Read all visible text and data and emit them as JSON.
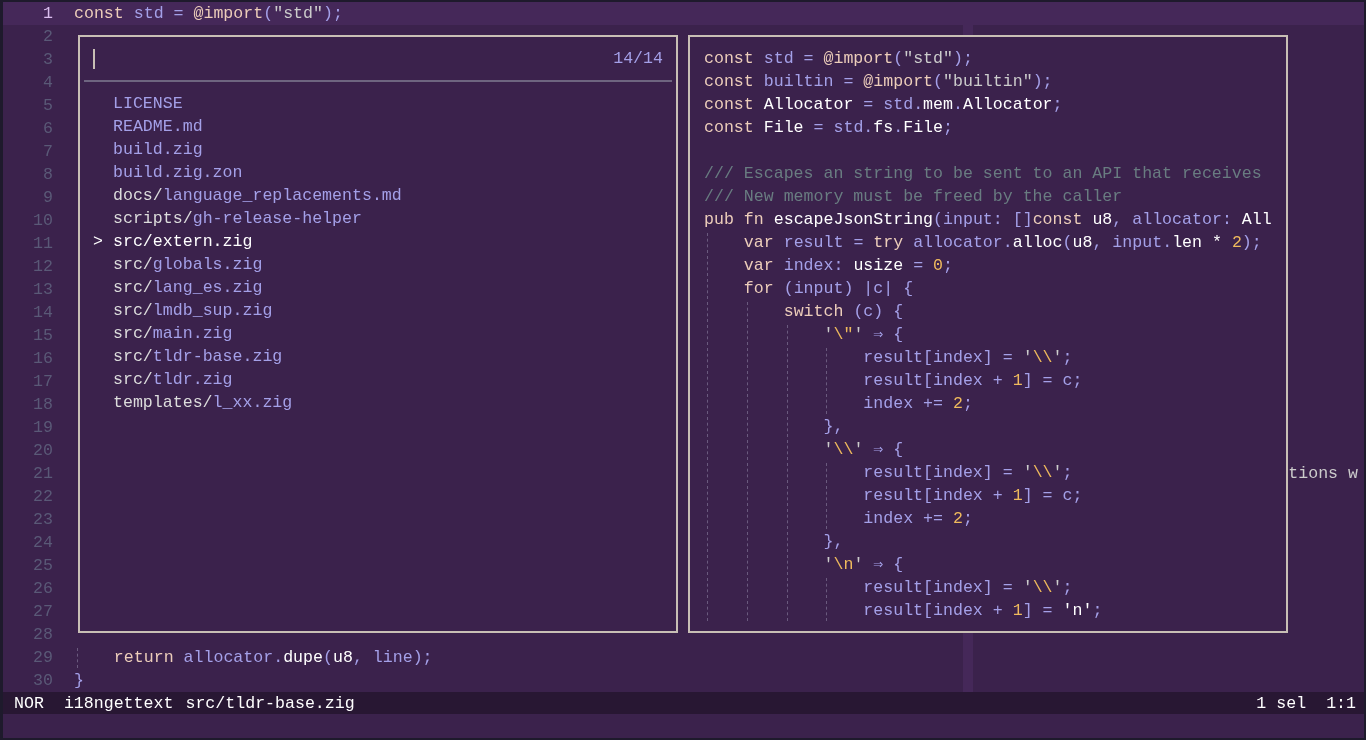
{
  "editor": {
    "lines": [
      {
        "number": "1",
        "kind": "code",
        "current": true,
        "tokens": [
          {
            "text": "const ",
            "kind": "keyword"
          },
          {
            "text": "std",
            "kind": "variable"
          },
          {
            "text": " = ",
            "kind": "variable"
          },
          {
            "text": "@import",
            "kind": "keyword"
          },
          {
            "text": "(",
            "kind": "variable"
          },
          {
            "text": "\"std\"",
            "kind": "string"
          },
          {
            "text": ");",
            "kind": "variable"
          }
        ]
      },
      {
        "number": "2",
        "kind": "blank",
        "current": false
      },
      {
        "number": "3",
        "kind": "blank",
        "current": false
      },
      {
        "number": "4",
        "kind": "blank",
        "current": false
      },
      {
        "number": "5",
        "kind": "blank",
        "current": false
      },
      {
        "number": "6",
        "kind": "blank",
        "current": false
      },
      {
        "number": "7",
        "kind": "blank",
        "current": false
      },
      {
        "number": "8",
        "kind": "blank",
        "current": false
      },
      {
        "number": "9",
        "kind": "blank",
        "current": false
      },
      {
        "number": "10",
        "kind": "blank",
        "current": false
      },
      {
        "number": "11",
        "kind": "blank",
        "current": false
      },
      {
        "number": "12",
        "kind": "blank",
        "current": false
      },
      {
        "number": "13",
        "kind": "blank",
        "current": false
      },
      {
        "number": "14",
        "kind": "blank",
        "current": false
      },
      {
        "number": "15",
        "kind": "blank",
        "current": false
      },
      {
        "number": "16",
        "kind": "blank",
        "current": false
      },
      {
        "number": "17",
        "kind": "blank",
        "current": false
      },
      {
        "number": "18",
        "kind": "blank",
        "current": false
      },
      {
        "number": "19",
        "kind": "blank",
        "current": false
      },
      {
        "number": "20",
        "kind": "blank",
        "current": false
      },
      {
        "number": "21",
        "kind": "clipped",
        "current": false,
        "tokens": [
          {
            "text": "tions w",
            "kind": "string"
          }
        ]
      },
      {
        "number": "22",
        "kind": "blank",
        "current": false
      },
      {
        "number": "23",
        "kind": "blank",
        "current": false
      },
      {
        "number": "24",
        "kind": "blank",
        "current": false
      },
      {
        "number": "25",
        "kind": "blank",
        "current": false
      },
      {
        "number": "26",
        "kind": "blank",
        "current": false
      },
      {
        "number": "27",
        "kind": "blank",
        "current": false
      },
      {
        "number": "28",
        "kind": "blank",
        "current": false
      },
      {
        "number": "29",
        "kind": "code",
        "current": false,
        "tokens": [
          {
            "text": "    return ",
            "kind": "keyword"
          },
          {
            "text": "allocator",
            "kind": "variable"
          },
          {
            "text": ".",
            "kind": "variable"
          },
          {
            "text": "dupe",
            "kind": "function"
          },
          {
            "text": "(",
            "kind": "variable"
          },
          {
            "text": "u8",
            "kind": "function"
          },
          {
            "text": ", ",
            "kind": "variable"
          },
          {
            "text": "line",
            "kind": "variable"
          },
          {
            "text": ");",
            "kind": "variable"
          }
        ]
      },
      {
        "number": "30",
        "kind": "code",
        "current": false,
        "tokens": [
          {
            "text": "}",
            "kind": "variable"
          }
        ]
      }
    ]
  },
  "picker": {
    "count": "14/14",
    "marker": ">",
    "items": [
      {
        "name": "LICENSE",
        "selected": false
      },
      {
        "name": "README.md",
        "selected": false
      },
      {
        "name": "build.zig",
        "selected": false
      },
      {
        "name": "build.zig.zon",
        "selected": false
      },
      {
        "dir": "docs/",
        "name": "language_replacements.md",
        "selected": false
      },
      {
        "dir": "scripts/",
        "name": "gh-release-helper",
        "selected": false
      },
      {
        "dir": "src/",
        "name": "extern.zig",
        "selected": true
      },
      {
        "dir": "src/",
        "name": "globals.zig",
        "selected": false
      },
      {
        "dir": "src/",
        "name": "lang_es.zig",
        "selected": false
      },
      {
        "dir": "src/",
        "name": "lmdb_sup.zig",
        "selected": false
      },
      {
        "dir": "src/",
        "name": "main.zig",
        "selected": false
      },
      {
        "dir": "src/",
        "name": "tldr-base.zig",
        "selected": false
      },
      {
        "dir": "src/",
        "name": "tldr.zig",
        "selected": false
      },
      {
        "dir": "templates/",
        "name": "l_xx.zig",
        "selected": false
      }
    ]
  },
  "preview": {
    "lines": [
      {
        "kind": "code",
        "tokens": [
          {
            "text": "const ",
            "kind": "keyword"
          },
          {
            "text": "std",
            "kind": "variable"
          },
          {
            "text": " = ",
            "kind": "variable"
          },
          {
            "text": "@import",
            "kind": "keyword"
          },
          {
            "text": "(",
            "kind": "variable"
          },
          {
            "text": "\"std\"",
            "kind": "string"
          },
          {
            "text": ");",
            "kind": "variable"
          }
        ]
      },
      {
        "kind": "code",
        "tokens": [
          {
            "text": "const ",
            "kind": "keyword"
          },
          {
            "text": "builtin",
            "kind": "variable"
          },
          {
            "text": " = ",
            "kind": "variable"
          },
          {
            "text": "@import",
            "kind": "keyword"
          },
          {
            "text": "(",
            "kind": "variable"
          },
          {
            "text": "\"builtin\"",
            "kind": "string"
          },
          {
            "text": ");",
            "kind": "variable"
          }
        ]
      },
      {
        "kind": "code",
        "tokens": [
          {
            "text": "const ",
            "kind": "keyword"
          },
          {
            "text": "Allocator",
            "kind": "function"
          },
          {
            "text": " = ",
            "kind": "variable"
          },
          {
            "text": "std",
            "kind": "variable"
          },
          {
            "text": ".",
            "kind": "variable"
          },
          {
            "text": "mem",
            "kind": "function"
          },
          {
            "text": ".",
            "kind": "variable"
          },
          {
            "text": "Allocator",
            "kind": "function"
          },
          {
            "text": ";",
            "kind": "variable"
          }
        ]
      },
      {
        "kind": "code",
        "tokens": [
          {
            "text": "const ",
            "kind": "keyword"
          },
          {
            "text": "File",
            "kind": "function"
          },
          {
            "text": " = ",
            "kind": "variable"
          },
          {
            "text": "std",
            "kind": "variable"
          },
          {
            "text": ".",
            "kind": "variable"
          },
          {
            "text": "fs",
            "kind": "function"
          },
          {
            "text": ".",
            "kind": "variable"
          },
          {
            "text": "File",
            "kind": "function"
          },
          {
            "text": ";",
            "kind": "variable"
          }
        ]
      },
      {
        "kind": "blank"
      },
      {
        "kind": "code",
        "tokens": [
          {
            "text": "/// Escapes an string to be sent to an API that receives",
            "kind": "comment"
          }
        ]
      },
      {
        "kind": "code",
        "tokens": [
          {
            "text": "/// New memory must be freed by the caller",
            "kind": "comment"
          }
        ]
      },
      {
        "kind": "code",
        "tokens": [
          {
            "text": "pub fn ",
            "kind": "keyword"
          },
          {
            "text": "escapeJsonString",
            "kind": "function"
          },
          {
            "text": "(",
            "kind": "variable"
          },
          {
            "text": "input",
            "kind": "variable"
          },
          {
            "text": ": []",
            "kind": "variable"
          },
          {
            "text": "const ",
            "kind": "keyword"
          },
          {
            "text": "u8",
            "kind": "function"
          },
          {
            "text": ", ",
            "kind": "variable"
          },
          {
            "text": "allocator",
            "kind": "variable"
          },
          {
            "text": ": ",
            "kind": "variable"
          },
          {
            "text": "All",
            "kind": "function"
          }
        ]
      },
      {
        "kind": "code",
        "tokens": [
          {
            "text": "    var ",
            "kind": "keyword"
          },
          {
            "text": "result",
            "kind": "variable"
          },
          {
            "text": " = ",
            "kind": "variable"
          },
          {
            "text": "try ",
            "kind": "keyword"
          },
          {
            "text": "allocator",
            "kind": "variable"
          },
          {
            "text": ".",
            "kind": "variable"
          },
          {
            "text": "alloc",
            "kind": "function"
          },
          {
            "text": "(",
            "kind": "variable"
          },
          {
            "text": "u8",
            "kind": "function"
          },
          {
            "text": ", ",
            "kind": "variable"
          },
          {
            "text": "input",
            "kind": "variable"
          },
          {
            "text": ".",
            "kind": "variable"
          },
          {
            "text": "len",
            "kind": "function"
          },
          {
            "text": " * ",
            "kind": "function"
          },
          {
            "text": "2",
            "kind": "number"
          },
          {
            "text": ");",
            "kind": "variable"
          }
        ]
      },
      {
        "kind": "code",
        "tokens": [
          {
            "text": "    var ",
            "kind": "keyword"
          },
          {
            "text": "index",
            "kind": "variable"
          },
          {
            "text": ": ",
            "kind": "variable"
          },
          {
            "text": "usize",
            "kind": "function"
          },
          {
            "text": " = ",
            "kind": "variable"
          },
          {
            "text": "0",
            "kind": "number"
          },
          {
            "text": ";",
            "kind": "variable"
          }
        ]
      },
      {
        "kind": "code",
        "tokens": [
          {
            "text": "    for ",
            "kind": "keyword"
          },
          {
            "text": "(input) |c| {",
            "kind": "variable"
          }
        ]
      },
      {
        "kind": "code",
        "tokens": [
          {
            "text": "        switch ",
            "kind": "keyword"
          },
          {
            "text": "(c) {",
            "kind": "variable"
          }
        ]
      },
      {
        "kind": "code",
        "tokens": [
          {
            "text": "            '",
            "kind": "string"
          },
          {
            "text": "\\\"",
            "kind": "number"
          },
          {
            "text": "'",
            "kind": "string"
          },
          {
            "text": " ⇒ {",
            "kind": "variable"
          }
        ]
      },
      {
        "kind": "code",
        "tokens": [
          {
            "text": "                result[index] = ",
            "kind": "variable"
          },
          {
            "text": "'",
            "kind": "string"
          },
          {
            "text": "\\\\",
            "kind": "number"
          },
          {
            "text": "'",
            "kind": "string"
          },
          {
            "text": ";",
            "kind": "variable"
          }
        ]
      },
      {
        "kind": "code",
        "tokens": [
          {
            "text": "                result[index + ",
            "kind": "variable"
          },
          {
            "text": "1",
            "kind": "number"
          },
          {
            "text": "] = c;",
            "kind": "variable"
          }
        ]
      },
      {
        "kind": "code",
        "tokens": [
          {
            "text": "                index += ",
            "kind": "variable"
          },
          {
            "text": "2",
            "kind": "number"
          },
          {
            "text": ";",
            "kind": "variable"
          }
        ]
      },
      {
        "kind": "code",
        "tokens": [
          {
            "text": "            },",
            "kind": "variable"
          }
        ]
      },
      {
        "kind": "code",
        "tokens": [
          {
            "text": "            '",
            "kind": "string"
          },
          {
            "text": "\\\\",
            "kind": "number"
          },
          {
            "text": "'",
            "kind": "string"
          },
          {
            "text": " ⇒ {",
            "kind": "variable"
          }
        ]
      },
      {
        "kind": "code",
        "tokens": [
          {
            "text": "                result[index] = ",
            "kind": "variable"
          },
          {
            "text": "'",
            "kind": "string"
          },
          {
            "text": "\\\\",
            "kind": "number"
          },
          {
            "text": "'",
            "kind": "string"
          },
          {
            "text": ";",
            "kind": "variable"
          }
        ]
      },
      {
        "kind": "code",
        "tokens": [
          {
            "text": "                result[index + ",
            "kind": "variable"
          },
          {
            "text": "1",
            "kind": "number"
          },
          {
            "text": "] = c;",
            "kind": "variable"
          }
        ]
      },
      {
        "kind": "code",
        "tokens": [
          {
            "text": "                index += ",
            "kind": "variable"
          },
          {
            "text": "2",
            "kind": "number"
          },
          {
            "text": ";",
            "kind": "variable"
          }
        ]
      },
      {
        "kind": "code",
        "tokens": [
          {
            "text": "            },",
            "kind": "variable"
          }
        ]
      },
      {
        "kind": "code",
        "tokens": [
          {
            "text": "            '",
            "kind": "string"
          },
          {
            "text": "\\n",
            "kind": "number"
          },
          {
            "text": "'",
            "kind": "string"
          },
          {
            "text": " ⇒ {",
            "kind": "variable"
          }
        ]
      },
      {
        "kind": "code",
        "tokens": [
          {
            "text": "                result[index] = ",
            "kind": "variable"
          },
          {
            "text": "'",
            "kind": "string"
          },
          {
            "text": "\\\\",
            "kind": "number"
          },
          {
            "text": "'",
            "kind": "string"
          },
          {
            "text": ";",
            "kind": "variable"
          }
        ]
      },
      {
        "kind": "code",
        "tokens": [
          {
            "text": "                result[index + ",
            "kind": "variable"
          },
          {
            "text": "1",
            "kind": "number"
          },
          {
            "text": "] = ",
            "kind": "variable"
          },
          {
            "text": "'n'",
            "kind": "function"
          },
          {
            "text": ";",
            "kind": "variable"
          }
        ]
      }
    ]
  },
  "status_bar": {
    "mode": "NOR",
    "project": "i18ngettext",
    "file": "src/tldr-base.zig",
    "selections": "1 sel",
    "position": "1:1"
  }
}
